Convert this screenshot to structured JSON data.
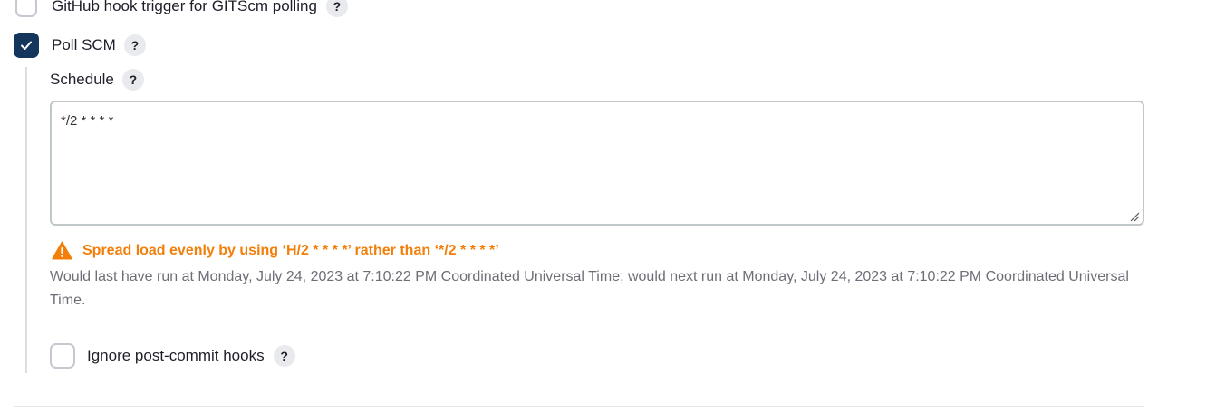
{
  "triggers": {
    "github_hook": {
      "label": "GitHub hook trigger for GITScm polling",
      "checked": false,
      "help": "?"
    },
    "poll_scm": {
      "label": "Poll SCM",
      "checked": true,
      "help": "?"
    }
  },
  "schedule": {
    "label": "Schedule",
    "help": "?",
    "value": "*/2 * * * *"
  },
  "validation": {
    "warning_text": "Spread load evenly by using ‘H/2 * * * *’ rather than ‘*/2 * * * *’",
    "info_text": "Would last have run at Monday, July 24, 2023 at 7:10:22 PM Coordinated Universal Time; would next run at Monday, July 24, 2023 at 7:10:22 PM Coordinated Universal Time."
  },
  "ignore_post_commit": {
    "label": "Ignore post-commit hooks",
    "checked": false,
    "help": "?"
  },
  "colors": {
    "checkbox_checked": "#14365c",
    "warning": "#f37f0b",
    "info_text": "#6d6e78"
  },
  "icons": {
    "check": "check-icon",
    "warning": "warning-triangle-icon",
    "help": "question-mark-icon",
    "resize": "resize-handle-icon"
  }
}
